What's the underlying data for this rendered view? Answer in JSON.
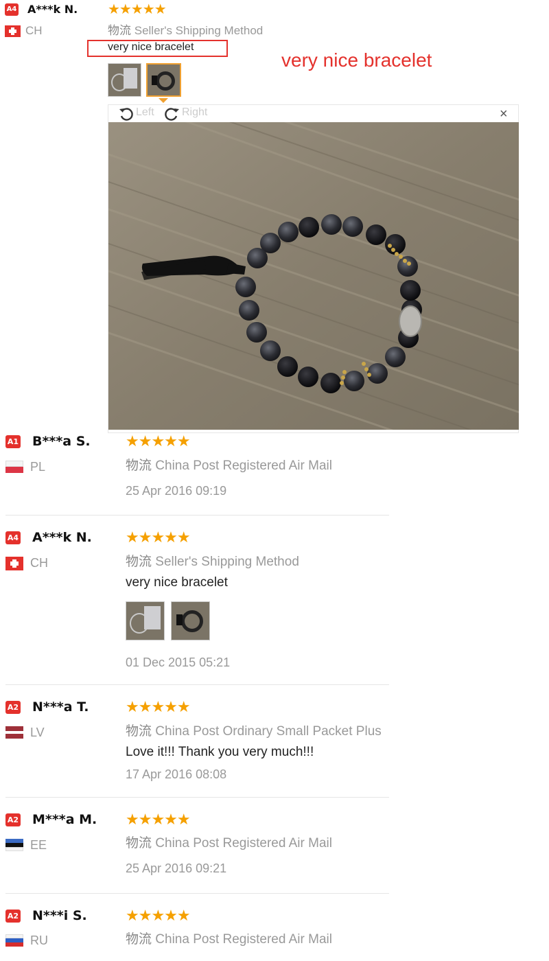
{
  "colors": {
    "star": "#f5a000",
    "badge_red": "#e4312c",
    "annotation_red": "#e4312c",
    "muted": "#999999"
  },
  "preview": {
    "left_label": "Left",
    "right_label": "Right",
    "close_symbol": "×"
  },
  "annotation": {
    "boxed_text": "very nice bracelet",
    "callout_text": "very nice bracelet"
  },
  "reviews": [
    {
      "badge": "A4",
      "name": "A***k N.",
      "country": "CH",
      "flag": "swiss-flag",
      "stars": "★★★★★",
      "ship_cn": "物流",
      "shipping": "Seller's Shipping Method",
      "comment": "very nice bracelet",
      "date": ""
    },
    {
      "badge": "A1",
      "name": "B***a S.",
      "country": "PL",
      "flag": "polish-flag",
      "stars": "★★★★★",
      "ship_cn": "物流",
      "shipping": "China Post Registered Air Mail",
      "comment": "",
      "date": "25 Apr 2016 09:19"
    },
    {
      "badge": "A4",
      "name": "A***k N.",
      "country": "CH",
      "flag": "swiss-flag",
      "stars": "★★★★★",
      "ship_cn": "物流",
      "shipping": "Seller's Shipping Method",
      "comment": "very nice bracelet",
      "date": "01 Dec 2015 05:21"
    },
    {
      "badge": "A2",
      "name": "N***a T.",
      "country": "LV",
      "flag": "latvian-flag",
      "stars": "★★★★★",
      "ship_cn": "物流",
      "shipping": "China Post Ordinary Small Packet Plus",
      "comment": "Love it!!! Thank you very much!!!",
      "date": "17 Apr 2016 08:08"
    },
    {
      "badge": "A2",
      "name": "M***a M.",
      "country": "EE",
      "flag": "estonian-flag",
      "stars": "★★★★★",
      "ship_cn": "物流",
      "shipping": "China Post Registered Air Mail",
      "comment": "",
      "date": "25 Apr 2016 09:21"
    },
    {
      "badge": "A2",
      "name": "N***i S.",
      "country": "RU",
      "flag": "russian-flag",
      "stars": "★★★★★",
      "ship_cn": "物流",
      "shipping": "China Post Registered Air Mail",
      "comment": "",
      "date": ""
    }
  ]
}
